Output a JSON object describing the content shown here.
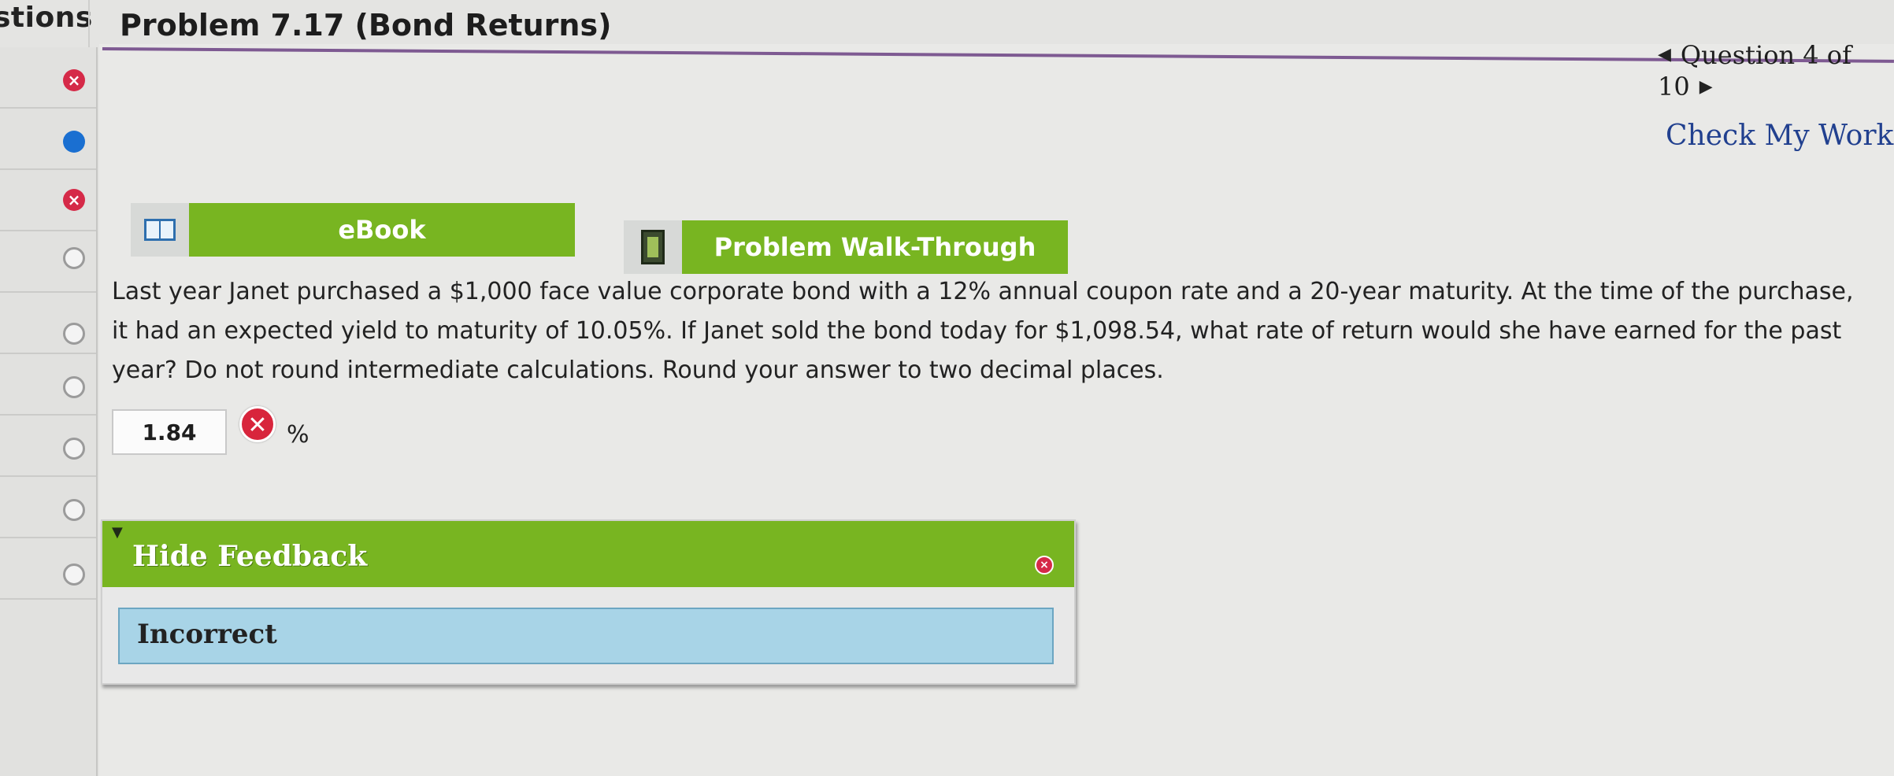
{
  "header": {
    "sidebar_heading": "stions",
    "page_title": "Problem 7.17 (Bond Returns)"
  },
  "sidebar": {
    "items": [
      {
        "status": "incorrect"
      },
      {
        "status": "current"
      },
      {
        "status": "incorrect"
      },
      {
        "status": "unanswered"
      },
      {
        "status": "unanswered"
      },
      {
        "status": "unanswered"
      },
      {
        "status": "unanswered"
      },
      {
        "status": "unanswered"
      },
      {
        "status": "unanswered"
      }
    ]
  },
  "nav": {
    "question_label": "Question 4 of 10",
    "prev_icon": "triangle-left-icon",
    "next_icon": "triangle-right-icon"
  },
  "check_work_label": "Check My Work",
  "resources": {
    "ebook_label": "eBook",
    "ebook_icon": "book-icon",
    "walkthrough_label": "Problem Walk-Through",
    "walkthrough_icon": "film-icon"
  },
  "problem": {
    "line1": "Last year Janet purchased a $1,000 face value corporate bond with a 12% annual coupon rate and a 20-year maturity. At the time of the purchase,",
    "line2": "it had an expected yield to maturity of 10.05%. If Janet sold the bond today for $1,098.54, what rate of return would she have earned for the past",
    "line3": "year? Do not round intermediate calculations. Round your answer to two decimal places."
  },
  "answer": {
    "value": "1.84",
    "unit": "%",
    "mark": "✕"
  },
  "feedback": {
    "title": "Hide Feedback",
    "result": "Incorrect"
  },
  "colors": {
    "accent_green": "#78b521",
    "incorrect_red": "#d52a48",
    "current_blue": "#1a6fd1",
    "link_blue": "#21408f",
    "feedback_blue": "#a8d4e7"
  }
}
